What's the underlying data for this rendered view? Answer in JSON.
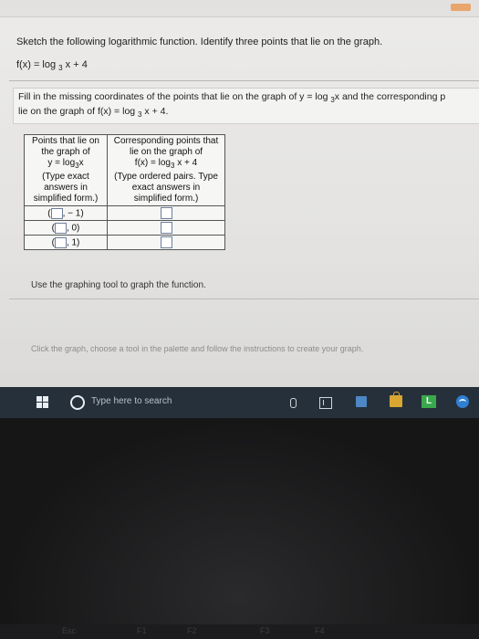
{
  "question": {
    "title": "Sketch the following logarithmic function. Identify three points that lie on the graph.",
    "function_prefix": "f(x) = log",
    "function_base": "3",
    "function_suffix": " x + 4"
  },
  "instructions": {
    "line1_prefix": "Fill in the missing coordinates of the points that lie on the graph of y = log",
    "line1_base": "3",
    "line1_suffix": "x and the corresponding p",
    "line2_prefix": "lie on the graph of f(x) = log",
    "line2_base": "3",
    "line2_suffix": " x + 4."
  },
  "table": {
    "header1_line1": "Points that lie on",
    "header1_line2": "the graph of",
    "header1_line3_prefix": "y = log",
    "header1_line3_base": "3",
    "header1_line3_suffix": "x",
    "header1_note1": "(Type exact",
    "header1_note2": "answers in",
    "header1_note3": "simplified form.)",
    "header2_line1": "Corresponding points that",
    "header2_line2": "lie on the graph of",
    "header2_line3_prefix": "f(x) = log",
    "header2_line3_base": "3",
    "header2_line3_suffix": " x + 4",
    "header2_note1": "(Type ordered pairs. Type",
    "header2_note2": "exact answers in",
    "header2_note3": "simplified form.)",
    "rows": [
      {
        "y_value": ", − 1)"
      },
      {
        "y_value": ", 0)"
      },
      {
        "y_value": ", 1)"
      }
    ]
  },
  "graph": {
    "instruction": "Use the graphing tool to graph the function.",
    "hint": "Click the graph, choose a tool in the palette and follow the instructions to create your graph."
  },
  "taskbar": {
    "search_placeholder": "Type here to search",
    "app_letter": "L"
  },
  "keyboard": {
    "keys": [
      "Esc",
      "F1",
      "F2",
      "F3",
      "F4"
    ]
  }
}
